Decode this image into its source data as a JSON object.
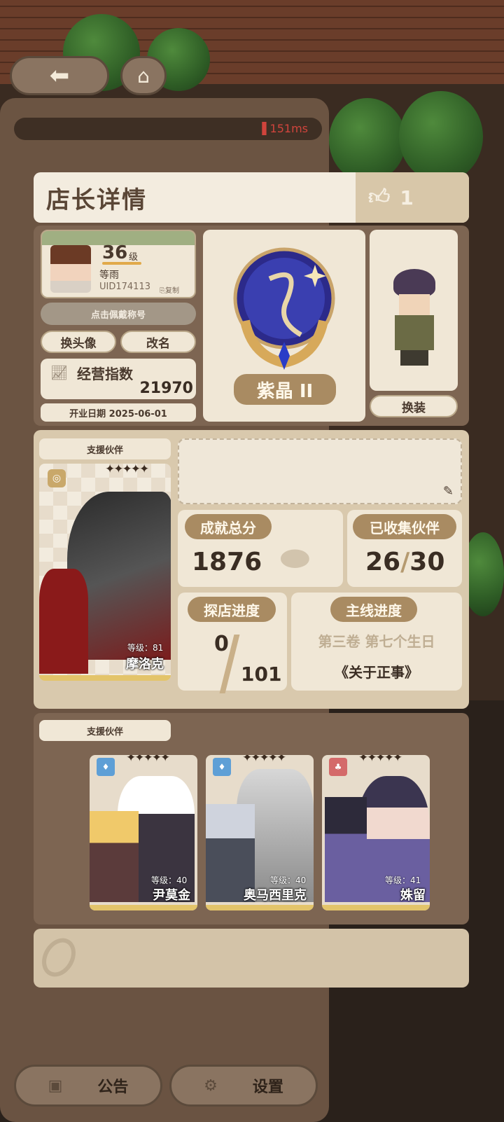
{
  "ping": "151ms",
  "panel_title": "店长详情",
  "likes": "1",
  "profile": {
    "level": "36",
    "level_unit": "级",
    "name": "等雨",
    "uid": "UID174113",
    "copy_label": "复制",
    "wear_title_label": "点击佩戴称号",
    "change_avatar": "换头像",
    "rename": "改名",
    "biz_index_label": "经营指数",
    "biz_index_value": "21970",
    "open_date": "开业日期 2025-06-01"
  },
  "rank": {
    "name": "紫晶 II"
  },
  "outfit_button": "换装",
  "support": {
    "label": "支援伙伴",
    "partner_level": "等级：81",
    "partner_name": "摩洛克"
  },
  "stats": {
    "achievement_label": "成就总分",
    "achievement_value": "1876",
    "collected_label": "已收集伙伴",
    "collected_value": "26",
    "collected_sep": "/",
    "collected_total": "30",
    "explore_label": "探店进度",
    "explore_value": "0",
    "explore_total": "101",
    "main_label": "主线进度",
    "main_chapter": "第三卷 第七个生日",
    "main_title": "《关于正事》"
  },
  "support2": {
    "label": "支援伙伴",
    "partners": [
      {
        "level": "等级：40",
        "name": "尹莫金"
      },
      {
        "level": "等级：40",
        "name": "奥马西里克"
      },
      {
        "level": "等级：41",
        "name": "姝留"
      }
    ]
  },
  "bottom": {
    "notice": "公告",
    "settings": "设置"
  },
  "colors": {
    "panel": "#7d6552",
    "cream": "#f0e7d6",
    "tag": "#a98b62",
    "rank_purple": "#3b2f8f"
  }
}
